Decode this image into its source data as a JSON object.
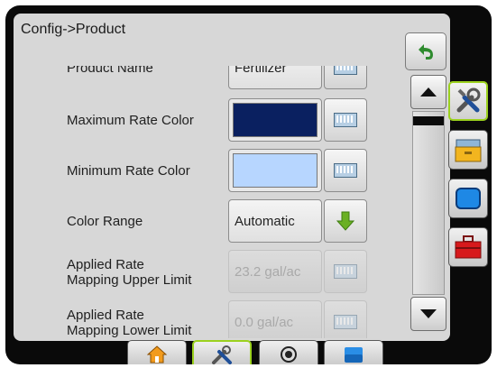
{
  "header": {
    "title": "Config->Product"
  },
  "settings": [
    {
      "label": "Product Name",
      "value": "Fertilizer",
      "type": "text"
    },
    {
      "label": "Maximum Rate Color",
      "color": "#0a2060",
      "type": "color"
    },
    {
      "label": "Minimum Rate Color",
      "color": "#b7d6ff",
      "type": "color"
    },
    {
      "label": "Color Range",
      "value": "Automatic",
      "type": "select"
    },
    {
      "label_line1": "Applied Rate",
      "label_line2": "Mapping Upper Limit",
      "value": "23.2 gal/ac",
      "type": "text-disabled"
    },
    {
      "label_line1": "Applied Rate",
      "label_line2": "Mapping Lower Limit",
      "value": "0.0 gal/ac",
      "type": "text-disabled"
    }
  ],
  "icons": {
    "back": "return-arrow-icon",
    "keyboard": "keyboard-icon",
    "down_arrow": "green-down-arrow-icon",
    "scroll_up": "scroll-up-icon",
    "scroll_down": "scroll-down-icon",
    "side_tabs": [
      "tools-icon",
      "console-icon",
      "display-icon",
      "toolbox-icon"
    ],
    "bottom_tabs": [
      "home-icon",
      "tools-icon",
      "gps-icon",
      "data-icon"
    ]
  },
  "colors": {
    "active_tab_border": "#9bd11e",
    "accent_green": "#6ab023"
  }
}
